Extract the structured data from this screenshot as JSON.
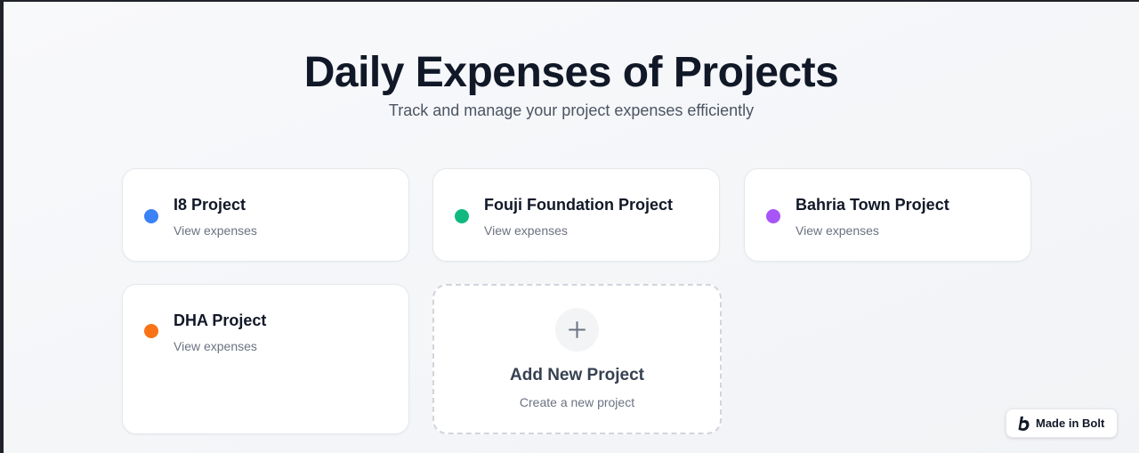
{
  "header": {
    "title": "Daily Expenses of Projects",
    "subtitle": "Track and manage your project expenses efficiently"
  },
  "projects": [
    {
      "name": "I8 Project",
      "subtitle": "View expenses",
      "color": "#3b82f6"
    },
    {
      "name": "Fouji Foundation Project",
      "subtitle": "View expenses",
      "color": "#10b981"
    },
    {
      "name": "Bahria Town Project",
      "subtitle": "View expenses",
      "color": "#a855f7"
    },
    {
      "name": "DHA Project",
      "subtitle": "View expenses",
      "color": "#f97316"
    }
  ],
  "add_project": {
    "title": "Add New Project",
    "subtitle": "Create a new project",
    "icon": "plus-icon"
  },
  "badge": {
    "label": "Made in Bolt",
    "icon": "bolt-logo-icon"
  }
}
